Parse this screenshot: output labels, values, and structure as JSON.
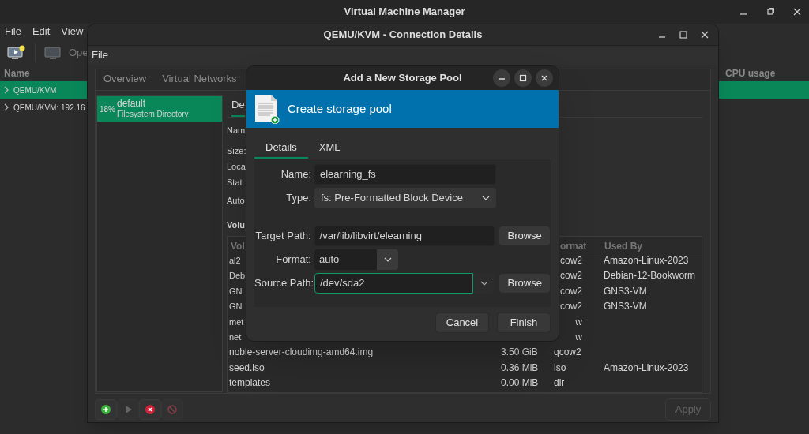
{
  "main_window": {
    "title": "Virtual Machine Manager",
    "menu": [
      "File",
      "Edit",
      "View"
    ],
    "toolbar_label": "Ope",
    "columns": [
      "Name",
      "CPU usage"
    ],
    "connections": [
      {
        "label": "QEMU/KVM",
        "selected": true
      },
      {
        "label": "QEMU/KVM: 192.16",
        "selected": false
      }
    ]
  },
  "connection_details": {
    "title": "QEMU/KVM - Connection Details",
    "menu": [
      "File"
    ],
    "tabs": [
      {
        "label": "Overview",
        "selected": false
      },
      {
        "label": "Virtual Networks",
        "selected": false
      }
    ],
    "pools": [
      {
        "usage": "18%",
        "name": "default",
        "type": "Filesystem Directory",
        "selected": true
      }
    ],
    "pool_tabs": [
      {
        "label": "De",
        "selected": true
      }
    ],
    "fields": [
      "Nam",
      "Size:",
      "Loca",
      "Stat",
      "Auto"
    ],
    "volumes_heading": "Volu",
    "volume_columns": [
      "Vol",
      "ormat",
      "Used By"
    ],
    "volumes": [
      {
        "name": "al2",
        "format": "cow2",
        "used_by": "Amazon-Linux-2023"
      },
      {
        "name": "Deb",
        "format": "cow2",
        "used_by": "Debian-12-Bookworm"
      },
      {
        "name": "GN",
        "format": "cow2",
        "used_by": "GNS3-VM"
      },
      {
        "name": "GN",
        "format": "cow2",
        "used_by": "GNS3-VM"
      },
      {
        "name": "met",
        "format": "w"
      },
      {
        "name": "net",
        "format": "w"
      },
      {
        "name": "noble-server-cloudimg-amd64.img",
        "size": "3.50 GiB",
        "format": "qcow2"
      },
      {
        "name": "seed.iso",
        "size": "0.36 MiB",
        "format": "iso",
        "used_by": "Amazon-Linux-2023"
      },
      {
        "name": "templates",
        "size": "0.00 MiB",
        "format": "dir"
      }
    ],
    "toolbar": [
      {
        "kind": "add",
        "disabled": false
      },
      {
        "kind": "start",
        "disabled": true
      },
      {
        "kind": "delete",
        "disabled": false
      },
      {
        "kind": "stop",
        "disabled": true
      }
    ],
    "apply": {
      "label": "Apply",
      "disabled": true
    }
  },
  "dialog": {
    "title": "Add a New Storage Pool",
    "header": "Create storage pool",
    "tabs": [
      {
        "label": "Details",
        "selected": true
      },
      {
        "label": "XML",
        "selected": false
      }
    ],
    "fields": [
      {
        "kind": "entry",
        "label": "Name:",
        "value": "elearning_fs",
        "focused": false
      },
      {
        "kind": "combo",
        "label": "Type:",
        "value": "fs: Pre-Formatted Block Device"
      },
      {
        "kind": "entry",
        "label": "Target Path:",
        "value": "/var/lib/libvirt/elearning",
        "focused": false,
        "button": "Browse"
      },
      {
        "kind": "combo-small",
        "label": "Format:",
        "value": "auto"
      },
      {
        "kind": "combo-entry",
        "label": "Source Path:",
        "value": "/dev/sda2",
        "focused": true,
        "button": "Browse"
      }
    ],
    "buttons": [
      "Cancel",
      "Finish"
    ]
  }
}
